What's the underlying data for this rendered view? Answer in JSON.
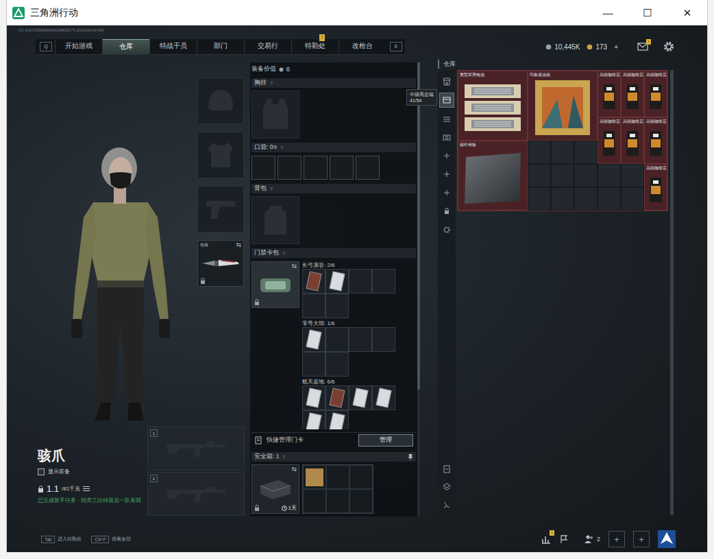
{
  "window": {
    "title": "三角洲行动",
    "controls": [
      {
        "name": "minimize",
        "glyph": "—"
      },
      {
        "name": "maximize",
        "glyph": "☐"
      },
      {
        "name": "close",
        "glyph": "✕"
      }
    ]
  },
  "session_id": "CN 8107299868980029808179.202608241409",
  "nav": {
    "prev_key": "Q",
    "next_key": "E",
    "tabs": [
      {
        "label": "开始游戏",
        "selected": false,
        "badge": ""
      },
      {
        "label": "仓库",
        "selected": true,
        "badge": ""
      },
      {
        "label": "特战干员",
        "selected": false,
        "badge": ""
      },
      {
        "label": "部门",
        "selected": false,
        "badge": ""
      },
      {
        "label": "交易行",
        "selected": false,
        "badge": ""
      },
      {
        "label": "特勤处",
        "selected": false,
        "badge": "!"
      },
      {
        "label": "改枪台",
        "selected": false,
        "badge": ""
      }
    ]
  },
  "wallet": {
    "coins": "10,445K",
    "tickets": "173",
    "add": "+",
    "mail_badge": "!"
  },
  "operator": {
    "name": "骇爪",
    "show_gear": {
      "label": "显示装备",
      "checked": false
    },
    "weight": "1.1",
    "weight_max": "/81千克",
    "notice": "已完成新手任务 · 拍卖三比特最后一队有我"
  },
  "gear_slots": [
    {
      "kind": "helmet",
      "label": "",
      "filled": false,
      "locked": false,
      "swap": ""
    },
    {
      "kind": "armor",
      "label": "",
      "filled": false,
      "locked": false,
      "swap": ""
    },
    {
      "kind": "pistol",
      "label": "",
      "filled": false,
      "locked": false,
      "swap": ""
    },
    {
      "kind": "melee",
      "label": "信条",
      "filled": true,
      "locked": true,
      "swap": "⇆"
    }
  ],
  "weapon_slots": [
    "1",
    "2"
  ],
  "loadout": {
    "value_label": "装备价值",
    "value": "0",
    "chest": {
      "label": "胸挂",
      "help": "?"
    },
    "pockets": {
      "label": "口袋:",
      "count": "0",
      "capacity": "/5",
      "help": "?",
      "slots": 5
    },
    "backpack": {
      "label": "背包",
      "help": "?"
    },
    "keycards": {
      "label": "门禁卡包",
      "help": "?",
      "locked": true,
      "swap": "⇆",
      "groups": [
        {
          "name": "长弓溪谷: 2/6",
          "slots": 6,
          "cards": [
            "#7a3f30",
            "#d8dcdf"
          ]
        },
        {
          "name": "零号大坝: 1/6",
          "slots": 6,
          "cards": [
            "#d8dcdf"
          ]
        },
        {
          "name": "航天基地: 6/6",
          "slots": 6,
          "cards": [
            "#d8dcdf",
            "#7a3f30",
            "#d8dcdf",
            "#d8dcdf",
            "#d8dcdf",
            "#d8dcdf"
          ]
        }
      ]
    },
    "quick_manage": {
      "label": "快捷管理门卡",
      "button": "管理"
    },
    "safe": {
      "label": "安全箱:",
      "count": "1",
      "help": "?",
      "timer": "1天",
      "locked": true,
      "swap": "⇆",
      "slots": 6,
      "items": [
        {
          "color": "#b08a4a"
        }
      ]
    }
  },
  "stash": {
    "label": "仓库",
    "tabs": [
      {
        "kind": "shop",
        "selected": false
      },
      {
        "kind": "box",
        "selected": true
      },
      {
        "kind": "stack",
        "selected": false
      },
      {
        "kind": "camera",
        "selected": false
      },
      {
        "kind": "add",
        "selected": false
      },
      {
        "kind": "add",
        "selected": false
      },
      {
        "kind": "add",
        "selected": false
      },
      {
        "kind": "lock",
        "selected": false
      },
      {
        "kind": "settings",
        "selected": false
      }
    ],
    "tools": [
      {
        "kind": "sort"
      },
      {
        "kind": "layers"
      },
      {
        "kind": "sweep"
      }
    ],
    "tooltip": {
      "title": "中级高息箱",
      "count": "41/54"
    },
    "items": [
      {
        "name": "重型军用电池",
        "kind": "battery",
        "slot": [
          1,
          1
        ],
        "size": [
          3,
          3
        ]
      },
      {
        "name": "印象派油画",
        "kind": "painting",
        "slot": [
          4,
          1
        ],
        "size": [
          3,
          3
        ]
      },
      {
        "name": "高级咖啡豆",
        "kind": "coffee",
        "slot": [
          7,
          1
        ],
        "size": [
          1,
          2
        ]
      },
      {
        "name": "高级咖啡豆",
        "kind": "coffee",
        "slot": [
          8,
          1
        ],
        "size": [
          1,
          2
        ]
      },
      {
        "name": "高级咖啡豆",
        "kind": "coffee",
        "slot": [
          9,
          1
        ],
        "size": [
          1,
          2
        ]
      },
      {
        "name": "高级咖啡豆",
        "kind": "coffee",
        "slot": [
          7,
          3
        ],
        "size": [
          1,
          2
        ]
      },
      {
        "name": "高级咖啡豆",
        "kind": "coffee",
        "slot": [
          8,
          3
        ],
        "size": [
          1,
          2
        ]
      },
      {
        "name": "高级咖啡豆",
        "kind": "coffee",
        "slot": [
          9,
          3
        ],
        "size": [
          1,
          2
        ]
      },
      {
        "name": "高级咖啡豆",
        "kind": "coffee",
        "slot": [
          9,
          5
        ],
        "size": [
          1,
          2
        ]
      },
      {
        "name": "碳纤维板",
        "kind": "plate",
        "slot": [
          1,
          4
        ],
        "size": [
          3,
          3
        ]
      }
    ]
  },
  "bottom": {
    "hints": [
      {
        "key": "Tab",
        "label": "进入特勤处"
      },
      {
        "key": "Ctrl F",
        "label": "搜索全部"
      }
    ],
    "stats_badge": "!",
    "squad_count": "2",
    "invite_slots": [
      "+",
      "+"
    ]
  }
}
